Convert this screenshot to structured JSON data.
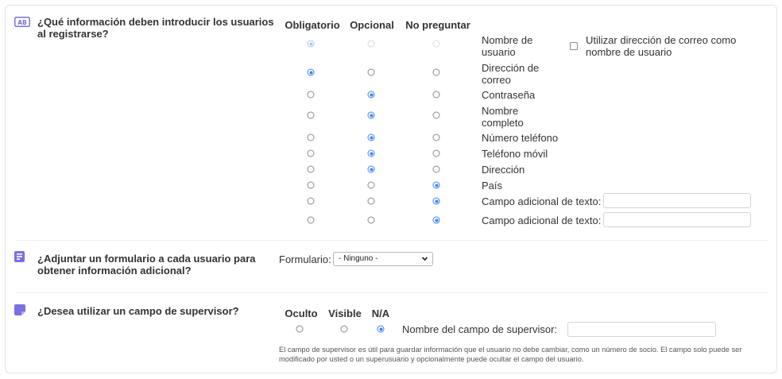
{
  "section1": {
    "icon": "ab-badge-icon",
    "question": "¿Qué información deben introducir los usuarios al registrarse?",
    "columns": [
      "Obligatorio",
      "Opcional",
      "No preguntar"
    ],
    "rows": [
      {
        "label": "Nombre de usuario",
        "selected": 0,
        "disabled": true
      },
      {
        "label": "Dirección de correo",
        "selected": 0,
        "disabled": false
      },
      {
        "label": "Contraseña",
        "selected": 1,
        "disabled": false
      },
      {
        "label": "Nombre completo",
        "selected": 1,
        "disabled": false
      },
      {
        "label": "Número teléfono",
        "selected": 1,
        "disabled": false
      },
      {
        "label": "Teléfono móvil",
        "selected": 1,
        "disabled": false
      },
      {
        "label": "Dirección",
        "selected": 1,
        "disabled": false
      },
      {
        "label": "País",
        "selected": 2,
        "disabled": false
      },
      {
        "label": "Campo adicional de texto:",
        "selected": 2,
        "disabled": false,
        "input_value": ""
      },
      {
        "label": "Campo adicional de texto:",
        "selected": 2,
        "disabled": false,
        "input_value": ""
      }
    ],
    "email_as_username": {
      "label": "Utilizar dirección de correo como nombre de usuario",
      "checked": false
    }
  },
  "section2": {
    "icon": "form-icon",
    "question": "¿Adjuntar un formulario a cada usuario para obtener información adicional?",
    "form_label": "Formulario:",
    "form_selected": "- Ninguno -"
  },
  "section3": {
    "icon": "sticky-note-icon",
    "question": "¿Desea utilizar un campo de supervisor?",
    "columns": [
      "Oculto",
      "Visible",
      "N/A"
    ],
    "selected": 2,
    "field_label": "Nombre del campo de supervisor:",
    "field_value": "",
    "note": "El campo de supervisor es útil para guardar información que el usuario no debe cambiar, como un número de socio. El campo solo puede ser modificado por usted o un superusuario y opcionalmente puede ocultar el campo del usuario."
  },
  "colors": {
    "accent": "#3b82f6",
    "icon": "#7b6fe0"
  }
}
